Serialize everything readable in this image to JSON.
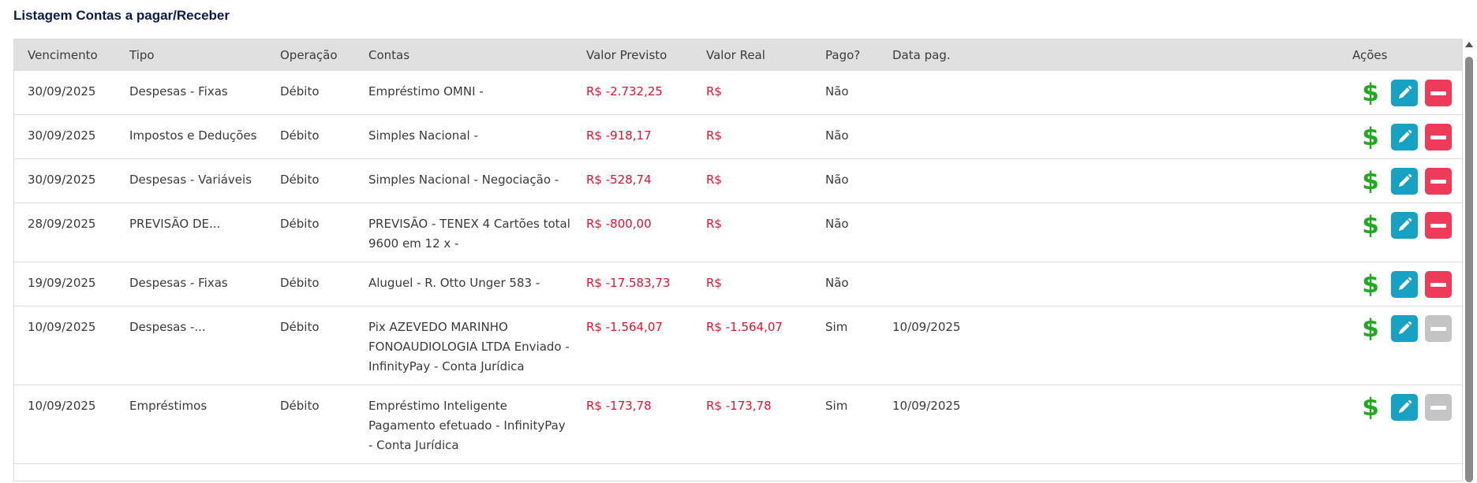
{
  "page": {
    "title": "Listagem Contas a pagar/Receber"
  },
  "table": {
    "headers": [
      "Vencimento",
      "Tipo",
      "Operação",
      "Contas",
      "Valor Previsto",
      "Valor Real",
      "Pago?",
      "Data pag.",
      "Ações"
    ],
    "rows": [
      {
        "vencimento": "30/09/2025",
        "tipo": "Despesas - Fixas",
        "operacao": "Débito",
        "contas": "Empréstimo OMNI -",
        "valor_previsto": "R$ -2.732,25",
        "valor_real": "R$",
        "pago": "Não",
        "data_pag": "",
        "delete_enabled": true
      },
      {
        "vencimento": "30/09/2025",
        "tipo": "Impostos e Deduções",
        "operacao": "Débito",
        "contas": "Simples Nacional -",
        "valor_previsto": "R$ -918,17",
        "valor_real": "R$",
        "pago": "Não",
        "data_pag": "",
        "delete_enabled": true
      },
      {
        "vencimento": "30/09/2025",
        "tipo": "Despesas - Variáveis",
        "operacao": "Débito",
        "contas": "Simples Nacional - Negociação -",
        "valor_previsto": "R$ -528,74",
        "valor_real": "R$",
        "pago": "Não",
        "data_pag": "",
        "delete_enabled": true
      },
      {
        "vencimento": "28/09/2025",
        "tipo": "PREVISÃO DE...",
        "operacao": "Débito",
        "contas": "PREVISÃO - TENEX 4 Cartões total 9600 em 12 x -",
        "valor_previsto": "R$ -800,00",
        "valor_real": "R$",
        "pago": "Não",
        "data_pag": "",
        "delete_enabled": true
      },
      {
        "vencimento": "19/09/2025",
        "tipo": "Despesas - Fixas",
        "operacao": "Débito",
        "contas": "Aluguel - R. Otto Unger 583 -",
        "valor_previsto": "R$ -17.583,73",
        "valor_real": "R$",
        "pago": "Não",
        "data_pag": "",
        "delete_enabled": true
      },
      {
        "vencimento": "10/09/2025",
        "tipo": "Despesas -...",
        "operacao": "Débito",
        "contas": "Pix AZEVEDO MARINHO FONOAUDIOLOGIA LTDA Enviado - InfinityPay - Conta Jurídica",
        "valor_previsto": "R$ -1.564,07",
        "valor_real": "R$ -1.564,07",
        "pago": "Sim",
        "data_pag": "10/09/2025",
        "delete_enabled": false
      },
      {
        "vencimento": "10/09/2025",
        "tipo": "Empréstimos",
        "operacao": "Débito",
        "contas": "Empréstimo Inteligente Pagamento efetuado - InfinityPay - Conta Jurídica",
        "valor_previsto": "R$ -173,78",
        "valor_real": "R$ -173,78",
        "pago": "Sim",
        "data_pag": "10/09/2025",
        "delete_enabled": false
      }
    ]
  },
  "icons": {
    "pay": "dollar-icon",
    "edit": "pencil-icon",
    "delete": "minus-icon"
  },
  "colors": {
    "negative": "#e8112d",
    "pay": "#1faa1f",
    "edit": "#17a2c4",
    "delete": "#ef3b5a",
    "delete_disabled": "#c4c4c4",
    "title": "#0d1b4c"
  }
}
